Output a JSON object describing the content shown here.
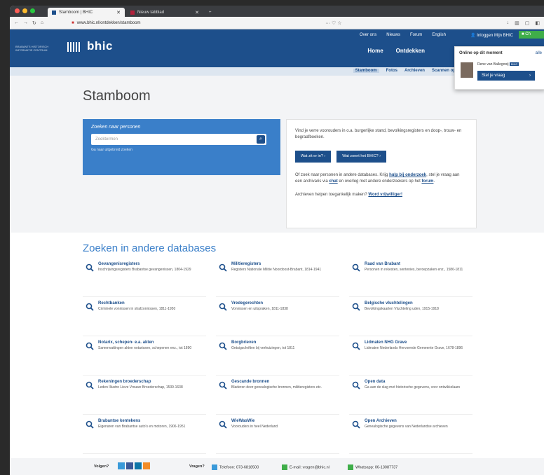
{
  "browser": {
    "tabs": [
      {
        "label": "Stamboom | BHIC"
      },
      {
        "label": "Nieuw tabblad"
      }
    ],
    "url": "www.bhic.nl/ontdekken/stamboom",
    "toolbar_right": "··· ♡ ☆"
  },
  "header": {
    "logo_small": "BRABANTS HISTORISCH INFORMATIE CENTRUM",
    "logo_text": "bhic",
    "top_links": [
      "Over ons",
      "Nieuws",
      "Forum",
      "English"
    ],
    "login": "Inloggen Mijn BHIC",
    "green_button": "Ch",
    "main_nav": [
      "Home",
      "Ontdekken"
    ]
  },
  "popup": {
    "title": "Online op dit moment",
    "more": "alle",
    "name": "Rene van Ballegooij",
    "badge": "BHIC",
    "button": "Stel je vraag"
  },
  "subnav": [
    "Stamboom",
    "Fotos",
    "Archieven",
    "Scannen op aanvraag"
  ],
  "page": {
    "title": "Stamboom",
    "search": {
      "title": "Zoeken naar personen",
      "placeholder": "Zoektermen",
      "link": "Ga naar uitgebreid zoeken"
    },
    "info": {
      "text1": "Vind je verre voorouders in o.a. burgerlijke stand, bevolkingsregisters en doop-, trouw- en begraafboeken.",
      "btn1": "Wat zit er in?",
      "btn2": "Wat zoent het BHIC?",
      "text2_a": "Of zoek naar personen in andere databases. Krijg ",
      "text2_link1": "hulp bij onderzoek",
      "text2_b": ", stel je vraag aan een archivaris via ",
      "text2_link2": "chat",
      "text2_c": " en overleg met andere onderzoekers op het ",
      "text2_link3": "forum",
      "text3": "Archieven helpen toegankelijk maken? ",
      "text3_link": "Word vrijwilliger!"
    },
    "db_title": "Zoeken in andere databases",
    "databases": [
      {
        "name": "Gevangenisregisters",
        "desc": "Inschrijvingsregisters Brabantse gevangenissen, 1804-1929"
      },
      {
        "name": "Militieregisters",
        "desc": "Registers Nationale Militie Noordoost-Brabant, 1814-1941"
      },
      {
        "name": "Raad van Brabant",
        "desc": "Personen in rekesten, sentenies, beroepzaken enz., 1586-1811"
      },
      {
        "name": "Rechtbanken",
        "desc": "Criminele vonnissen in strafzonnissen, 1811-1950"
      },
      {
        "name": "Vredegerechten",
        "desc": "Vonnissen en uitspraken, 1811-1838"
      },
      {
        "name": "Belgische vluchtelingen",
        "desc": "Bevolkingskaarten Vluchteling uden, 1915-1918"
      },
      {
        "name": "Notarix, schepen- e.a. akten",
        "desc": "Samenvattingen akten notarissen, schepenen enz., tot 1890"
      },
      {
        "name": "Borgbrieven",
        "desc": "Getuigschriften bij verhuizingen, tot 1811"
      },
      {
        "name": "Lidmaten NHG Grave",
        "desc": "Lidmaten Nederlands Hervormde Gemeente Grave, 1678-1896"
      },
      {
        "name": "Rekeningen broederschap",
        "desc": "Leden Illustre Lieve Vrouwe Broederschap, 1539-1638"
      },
      {
        "name": "Gescande bronnen",
        "desc": "Bladeren door genealogische bronnen, militieregisters etc."
      },
      {
        "name": "Open data",
        "desc": "Ga aan de slag met historische gegevens, voor ontwikkelaars"
      },
      {
        "name": "Brabantse kentekens",
        "desc": "Eigenaren van Brabantse auto's en motoren, 1906-1951"
      },
      {
        "name": "WieWasWie",
        "desc": "Voorouders in heel Nederland"
      },
      {
        "name": "Open Archieven",
        "desc": "Genealogische gegevens van Nederlandse archieven"
      }
    ]
  },
  "footer": {
    "follow": "Volgen?",
    "questions": "Vragen?",
    "phone": "Telefoon: 073-6818500",
    "mail": "E-mail: vragen@bhic.nl",
    "whatsapp": "Whatsapp: 06-13087737"
  },
  "colors": {
    "brand": "#1d4f8b",
    "accent": "#3a7fc9",
    "green": "#3fae49"
  }
}
